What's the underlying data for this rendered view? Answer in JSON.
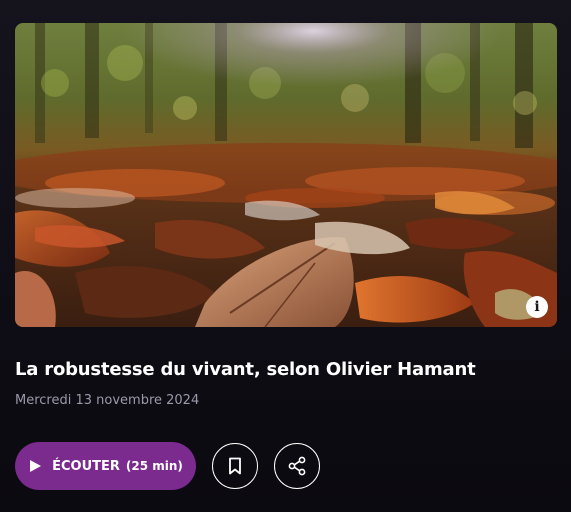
{
  "episode": {
    "title": "La robustesse du vivant, selon Olivier Hamant",
    "date": "Mercredi 13 novembre 2024",
    "image_alt": "autumn-leaves-forest-floor",
    "info_glyph": "i"
  },
  "actions": {
    "listen_label": "ÉCOUTER",
    "listen_duration": "(25 min)",
    "bookmark_icon": "bookmark-icon",
    "share_icon": "share-icon",
    "play_icon": "play-icon"
  },
  "colors": {
    "accent": "#7b2a8e",
    "background": "#0f0e14",
    "title": "#ffffff",
    "date": "#9b98a8"
  }
}
